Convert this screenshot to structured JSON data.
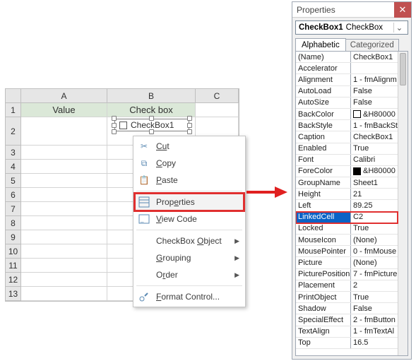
{
  "sheet": {
    "columns": [
      "A",
      "B",
      "C"
    ],
    "row_labels": [
      "1",
      "2",
      "3",
      "4",
      "5",
      "6",
      "7",
      "8",
      "9",
      "10",
      "11",
      "12",
      "13"
    ],
    "headers": {
      "A": "Value",
      "B": "Check box"
    },
    "checkbox_caption": "CheckBox1"
  },
  "context_menu": {
    "cut": "Cut",
    "copy": "Copy",
    "paste": "Paste",
    "properties": "Properties",
    "view_code": "View Code",
    "checkbox_object": "CheckBox Object",
    "grouping": "Grouping",
    "order": "Order",
    "format_control": "Format Control..."
  },
  "properties": {
    "title": "Properties",
    "combo_name": "CheckBox1",
    "combo_type": "CheckBox",
    "tab_alpha": "Alphabetic",
    "tab_cat": "Categorized",
    "rows": [
      {
        "n": "(Name)",
        "v": "CheckBox1"
      },
      {
        "n": "Accelerator",
        "v": ""
      },
      {
        "n": "Alignment",
        "v": "1 - fmAlignm"
      },
      {
        "n": "AutoLoad",
        "v": "False"
      },
      {
        "n": "AutoSize",
        "v": "False"
      },
      {
        "n": "BackColor",
        "v": "&H80000",
        "swatch": "white"
      },
      {
        "n": "BackStyle",
        "v": "1 - fmBackSt"
      },
      {
        "n": "Caption",
        "v": "CheckBox1"
      },
      {
        "n": "Enabled",
        "v": "True"
      },
      {
        "n": "Font",
        "v": "Calibri"
      },
      {
        "n": "ForeColor",
        "v": "&H80000",
        "swatch": "black"
      },
      {
        "n": "GroupName",
        "v": "Sheet1"
      },
      {
        "n": "Height",
        "v": "21"
      },
      {
        "n": "Left",
        "v": "89.25"
      },
      {
        "n": "LinkedCell",
        "v": "C2",
        "sel": true
      },
      {
        "n": "Locked",
        "v": "True"
      },
      {
        "n": "MouseIcon",
        "v": "(None)"
      },
      {
        "n": "MousePointer",
        "v": "0 - fmMouse"
      },
      {
        "n": "Picture",
        "v": "(None)"
      },
      {
        "n": "PicturePosition",
        "v": "7 - fmPicture"
      },
      {
        "n": "Placement",
        "v": "2"
      },
      {
        "n": "PrintObject",
        "v": "True"
      },
      {
        "n": "Shadow",
        "v": "False"
      },
      {
        "n": "SpecialEffect",
        "v": "2 - fmButton"
      },
      {
        "n": "TextAlign",
        "v": "1 - fmTextAl"
      },
      {
        "n": "Top",
        "v": "16.5"
      }
    ]
  }
}
